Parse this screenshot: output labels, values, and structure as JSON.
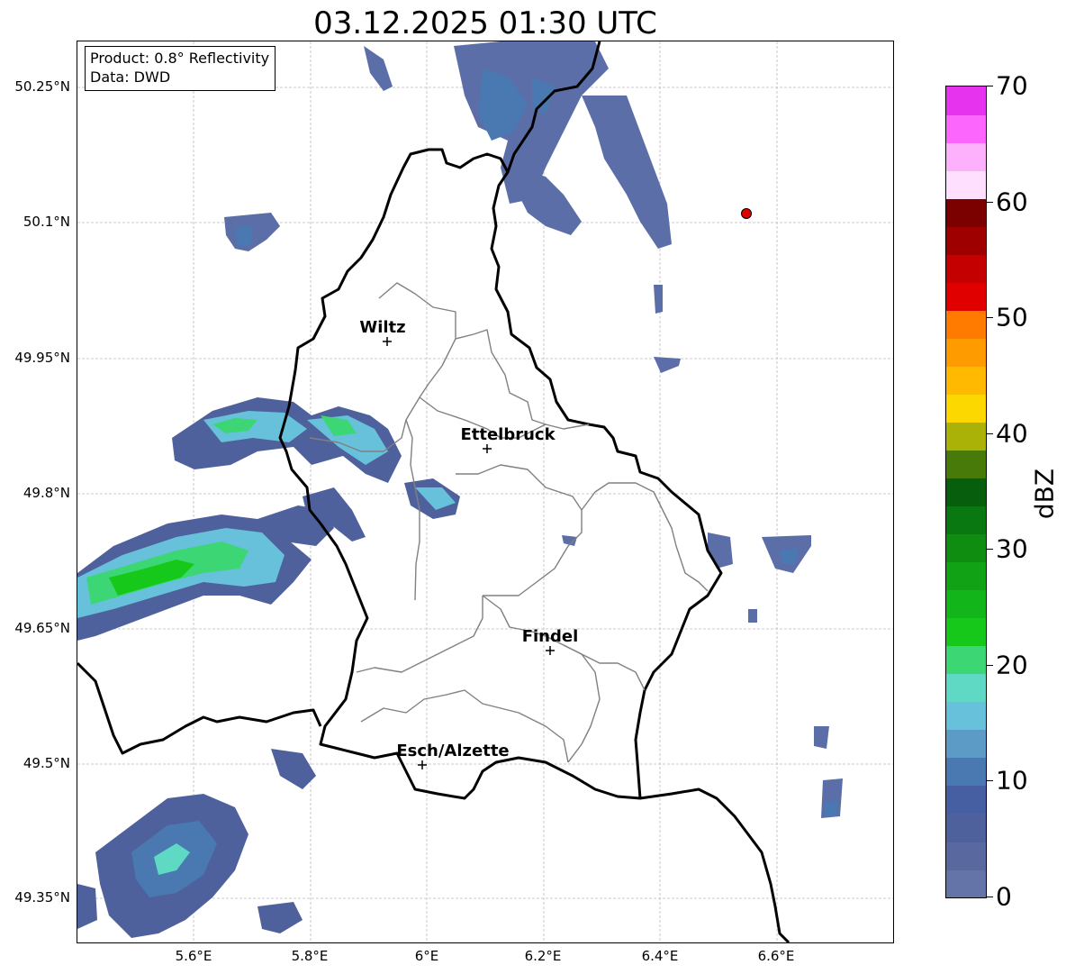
{
  "title": "03.12.2025 01:30 UTC",
  "product_box": {
    "line1": "Product: 0.8° Reflectivity",
    "line2": "Data: DWD"
  },
  "lat_axis": [
    {
      "label": "50.25°N",
      "value": 50.25
    },
    {
      "label": "50.1°N",
      "value": 50.1
    },
    {
      "label": "49.95°N",
      "value": 49.95
    },
    {
      "label": "49.8°N",
      "value": 49.8
    },
    {
      "label": "49.65°N",
      "value": 49.65
    },
    {
      "label": "49.5°N",
      "value": 49.5
    },
    {
      "label": "49.35°N",
      "value": 49.35
    }
  ],
  "lon_axis": [
    {
      "label": "5.6°E",
      "value": 5.6
    },
    {
      "label": "5.8°E",
      "value": 5.8
    },
    {
      "label": "6°E",
      "value": 6.0
    },
    {
      "label": "6.2°E",
      "value": 6.2
    },
    {
      "label": "6.4°E",
      "value": 6.4
    },
    {
      "label": "6.6°E",
      "value": 6.6
    }
  ],
  "map_extent": {
    "lon_min": 5.4,
    "lon_max": 6.8,
    "lat_min": 49.3,
    "lat_max": 50.3
  },
  "places": [
    {
      "name": "Wiltz",
      "lon": 5.93,
      "lat": 49.968
    },
    {
      "name": "Ettelbruck",
      "lon": 6.1,
      "lat": 49.848
    },
    {
      "name": "Findel",
      "lon": 6.21,
      "lat": 49.625
    },
    {
      "name": "Esch/Alzette",
      "lon": 5.99,
      "lat": 49.498
    }
  ],
  "radar_site": {
    "lon": 6.548,
    "lat": 50.11,
    "color": "#e00000"
  },
  "colorbar": {
    "unit": "dBZ",
    "min": 0,
    "max": 70,
    "step": 2.5,
    "tick_labels": [
      "0",
      "10",
      "20",
      "30",
      "40",
      "50",
      "60",
      "70"
    ],
    "tick_values": [
      0,
      10,
      20,
      30,
      40,
      50,
      60,
      70
    ],
    "colors": [
      "#6473a8",
      "#59699f",
      "#4f619c",
      "#465ea2",
      "#4a79b2",
      "#5b9bc6",
      "#67c1da",
      "#5fd8c4",
      "#3dd675",
      "#15c81a",
      "#12b61b",
      "#11a315",
      "#0e8d10",
      "#0a7811",
      "#075e0c",
      "#477a08",
      "#aab107",
      "#fdd800",
      "#feb900",
      "#fe9b00",
      "#fe7b00",
      "#e10000",
      "#c40000",
      "#9e0000",
      "#7b0000",
      "#fedffd",
      "#fdb1fd",
      "#fd66fd",
      "#e633ed"
    ]
  }
}
